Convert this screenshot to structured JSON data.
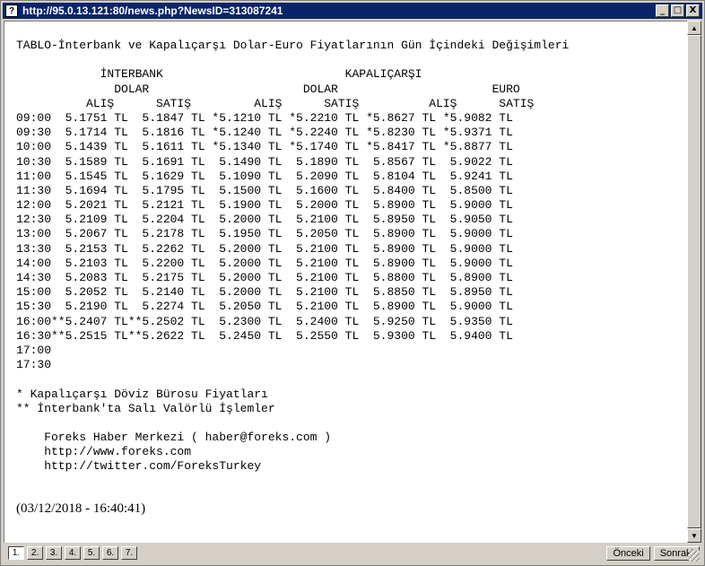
{
  "window": {
    "title": "http://95.0.13.121:80/news.php?NewsID=313087241",
    "title_icon": "?",
    "minimize": "_",
    "maximize": "□",
    "close": "X"
  },
  "article": {
    "lines": [
      "TABLO-İnterbank ve Kapalıçarşı Dolar-Euro Fiyatlarının Gün İçindeki Değişimleri",
      "",
      "            İNTERBANK                          KAPALIÇARŞI",
      "              DOLAR                      DOLAR                      EURO",
      "          ALIŞ      SATIŞ         ALIŞ      SATIŞ          ALIŞ      SATIŞ",
      "09:00  5.1751 TL  5.1847 TL *5.1210 TL *5.2210 TL *5.8627 TL *5.9082 TL",
      "09:30  5.1714 TL  5.1816 TL *5.1240 TL *5.2240 TL *5.8230 TL *5.9371 TL",
      "10:00  5.1439 TL  5.1611 TL *5.1340 TL *5.1740 TL *5.8417 TL *5.8877 TL",
      "10:30  5.1589 TL  5.1691 TL  5.1490 TL  5.1890 TL  5.8567 TL  5.9022 TL",
      "11:00  5.1545 TL  5.1629 TL  5.1090 TL  5.2090 TL  5.8104 TL  5.9241 TL",
      "11:30  5.1694 TL  5.1795 TL  5.1500 TL  5.1600 TL  5.8400 TL  5.8500 TL",
      "12:00  5.2021 TL  5.2121 TL  5.1900 TL  5.2000 TL  5.8900 TL  5.9000 TL",
      "12:30  5.2109 TL  5.2204 TL  5.2000 TL  5.2100 TL  5.8950 TL  5.9050 TL",
      "13:00  5.2067 TL  5.2178 TL  5.1950 TL  5.2050 TL  5.8900 TL  5.9000 TL",
      "13:30  5.2153 TL  5.2262 TL  5.2000 TL  5.2100 TL  5.8900 TL  5.9000 TL",
      "14:00  5.2103 TL  5.2200 TL  5.2000 TL  5.2100 TL  5.8900 TL  5.9000 TL",
      "14:30  5.2083 TL  5.2175 TL  5.2000 TL  5.2100 TL  5.8800 TL  5.8900 TL",
      "15:00  5.2052 TL  5.2140 TL  5.2000 TL  5.2100 TL  5.8850 TL  5.8950 TL",
      "15:30  5.2190 TL  5.2274 TL  5.2050 TL  5.2100 TL  5.8900 TL  5.9000 TL",
      "16:00**5.2407 TL**5.2502 TL  5.2300 TL  5.2400 TL  5.9250 TL  5.9350 TL",
      "16:30**5.2515 TL**5.2622 TL  5.2450 TL  5.2550 TL  5.9300 TL  5.9400 TL",
      "17:00",
      "17:30",
      "",
      "* Kapalıçarşı Döviz Bürosu Fiyatları",
      "** İnterbank'ta Salı Valörlü İşlemler",
      "",
      "    Foreks Haber Merkezi ( haber@foreks.com )",
      "    http://www.foreks.com",
      "    http://twitter.com/ForeksTurkey"
    ],
    "timestamp": "(03/12/2018 - 16:40:41)"
  },
  "pagination": {
    "pages": [
      "1.",
      "2.",
      "3.",
      "4.",
      "5.",
      "6.",
      "7."
    ],
    "active_index": 0,
    "prev_label": "Önceki",
    "next_label": "Sonraki"
  },
  "scrollbar": {
    "up": "▲",
    "down": "▼"
  }
}
